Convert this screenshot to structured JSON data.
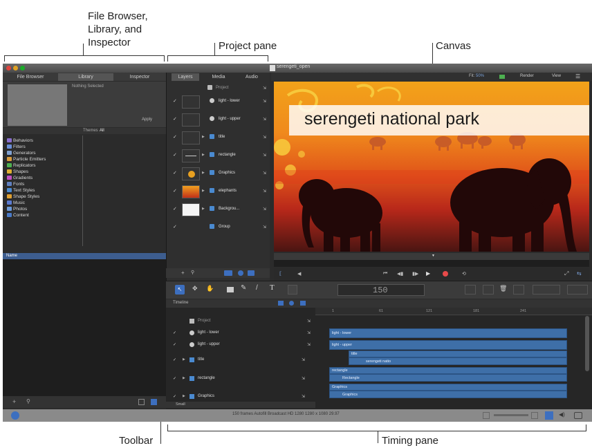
{
  "callouts": {
    "file_browser_1": "File Browser,",
    "file_browser_2": "Library, and",
    "file_browser_3": "Inspector",
    "project_pane": "Project pane",
    "canvas": "Canvas",
    "toolbar": "Toolbar",
    "timing_pane": "Timing pane"
  },
  "window": {
    "document_title": "serengeti_open"
  },
  "browser_tabs": [
    "File Browser",
    "Library",
    "Inspector"
  ],
  "project_tabs": [
    "Layers",
    "Media",
    "Audio"
  ],
  "preview": {
    "caption": "Nothing Selected",
    "apply": "Apply",
    "search_label": "Themes",
    "search_value": "All"
  },
  "library": {
    "items": [
      "Behaviors",
      "Filters",
      "Generators",
      "Particle Emitters",
      "Replicators",
      "Shapes",
      "Gradients",
      "Fonts",
      "Text Styles",
      "Shape Styles",
      "Music",
      "Photos",
      "Content"
    ],
    "list_header": "Name"
  },
  "layers": [
    {
      "name": "Project",
      "check": ""
    },
    {
      "name": "light - lower",
      "check": "✓"
    },
    {
      "name": "light - upper",
      "check": "✓"
    },
    {
      "name": "title",
      "check": "✓"
    },
    {
      "name": "rectangle",
      "check": "✓"
    },
    {
      "name": "Graphics",
      "check": "✓"
    },
    {
      "name": "elephants",
      "check": "✓"
    },
    {
      "name": "Backgrou...",
      "check": "✓"
    },
    {
      "name": "Group",
      "check": "✓"
    }
  ],
  "canvas": {
    "title_text": "serengeti national park",
    "fit_label": "Fit:",
    "fit_value": "50%",
    "render": "Render",
    "view": "View"
  },
  "toolbar": {
    "timecode": "150"
  },
  "timeline": {
    "label": "Timeline",
    "ruler": [
      "1",
      "61",
      "121",
      "181",
      "241"
    ],
    "rows": [
      "Project",
      "light - lower",
      "light - upper",
      "title",
      "rectangle",
      "Graphics"
    ],
    "bars": [
      "light - lower",
      "light - upper",
      "title",
      "serengeti natio",
      "rectangle",
      "Rectangle",
      "Graphics",
      "Graphics"
    ],
    "group_label": "Small"
  },
  "status_bar": {
    "text": "150 frames Autofill Broadcast HD 1280 1280 x 1080 29.97"
  },
  "colors": {
    "accent": "#3e6fa8",
    "panel": "#2b2b2b",
    "selection": "#3d5d8f"
  }
}
